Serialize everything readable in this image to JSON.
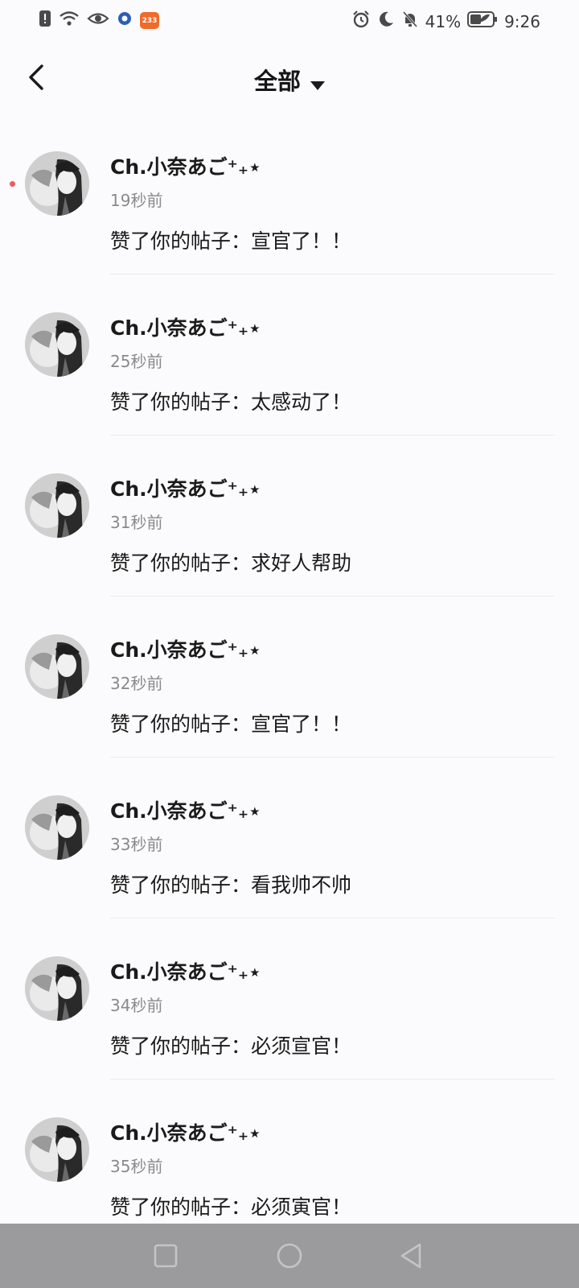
{
  "status_bar": {
    "left_icons": [
      "alert-icon",
      "wifi-icon",
      "eye-icon",
      "app-icon",
      "app-233-icon"
    ],
    "app_badge": "233",
    "battery": "41%",
    "time": "9:26"
  },
  "header": {
    "title": "全部"
  },
  "notifications": [
    {
      "name": "Ch.小奈あご⁺₊⋆",
      "time": "19秒前",
      "content": "赞了你的帖子：宣官了！！",
      "unread": true
    },
    {
      "name": "Ch.小奈あご⁺₊⋆",
      "time": "25秒前",
      "content": "赞了你的帖子：太感动了！"
    },
    {
      "name": "Ch.小奈あご⁺₊⋆",
      "time": "31秒前",
      "content": "赞了你的帖子：求好人帮助"
    },
    {
      "name": "Ch.小奈あご⁺₊⋆",
      "time": "32秒前",
      "content": "赞了你的帖子：宣官了！！"
    },
    {
      "name": "Ch.小奈あご⁺₊⋆",
      "time": "33秒前",
      "content": "赞了你的帖子：看我帅不帅"
    },
    {
      "name": "Ch.小奈あご⁺₊⋆",
      "time": "34秒前",
      "content": "赞了你的帖子：必须宣官！"
    },
    {
      "name": "Ch.小奈あご⁺₊⋆",
      "time": "35秒前",
      "content": "赞了你的帖子：必须寅官！"
    }
  ],
  "nav_bar": {
    "buttons": [
      "recents-icon",
      "home-icon",
      "back-icon"
    ]
  },
  "colors": {
    "background": "#fbfbfd",
    "unread_dot": "#ef5a5a",
    "nav_bar": "#9b9b9d",
    "secondary_text": "#8a8a8a"
  }
}
